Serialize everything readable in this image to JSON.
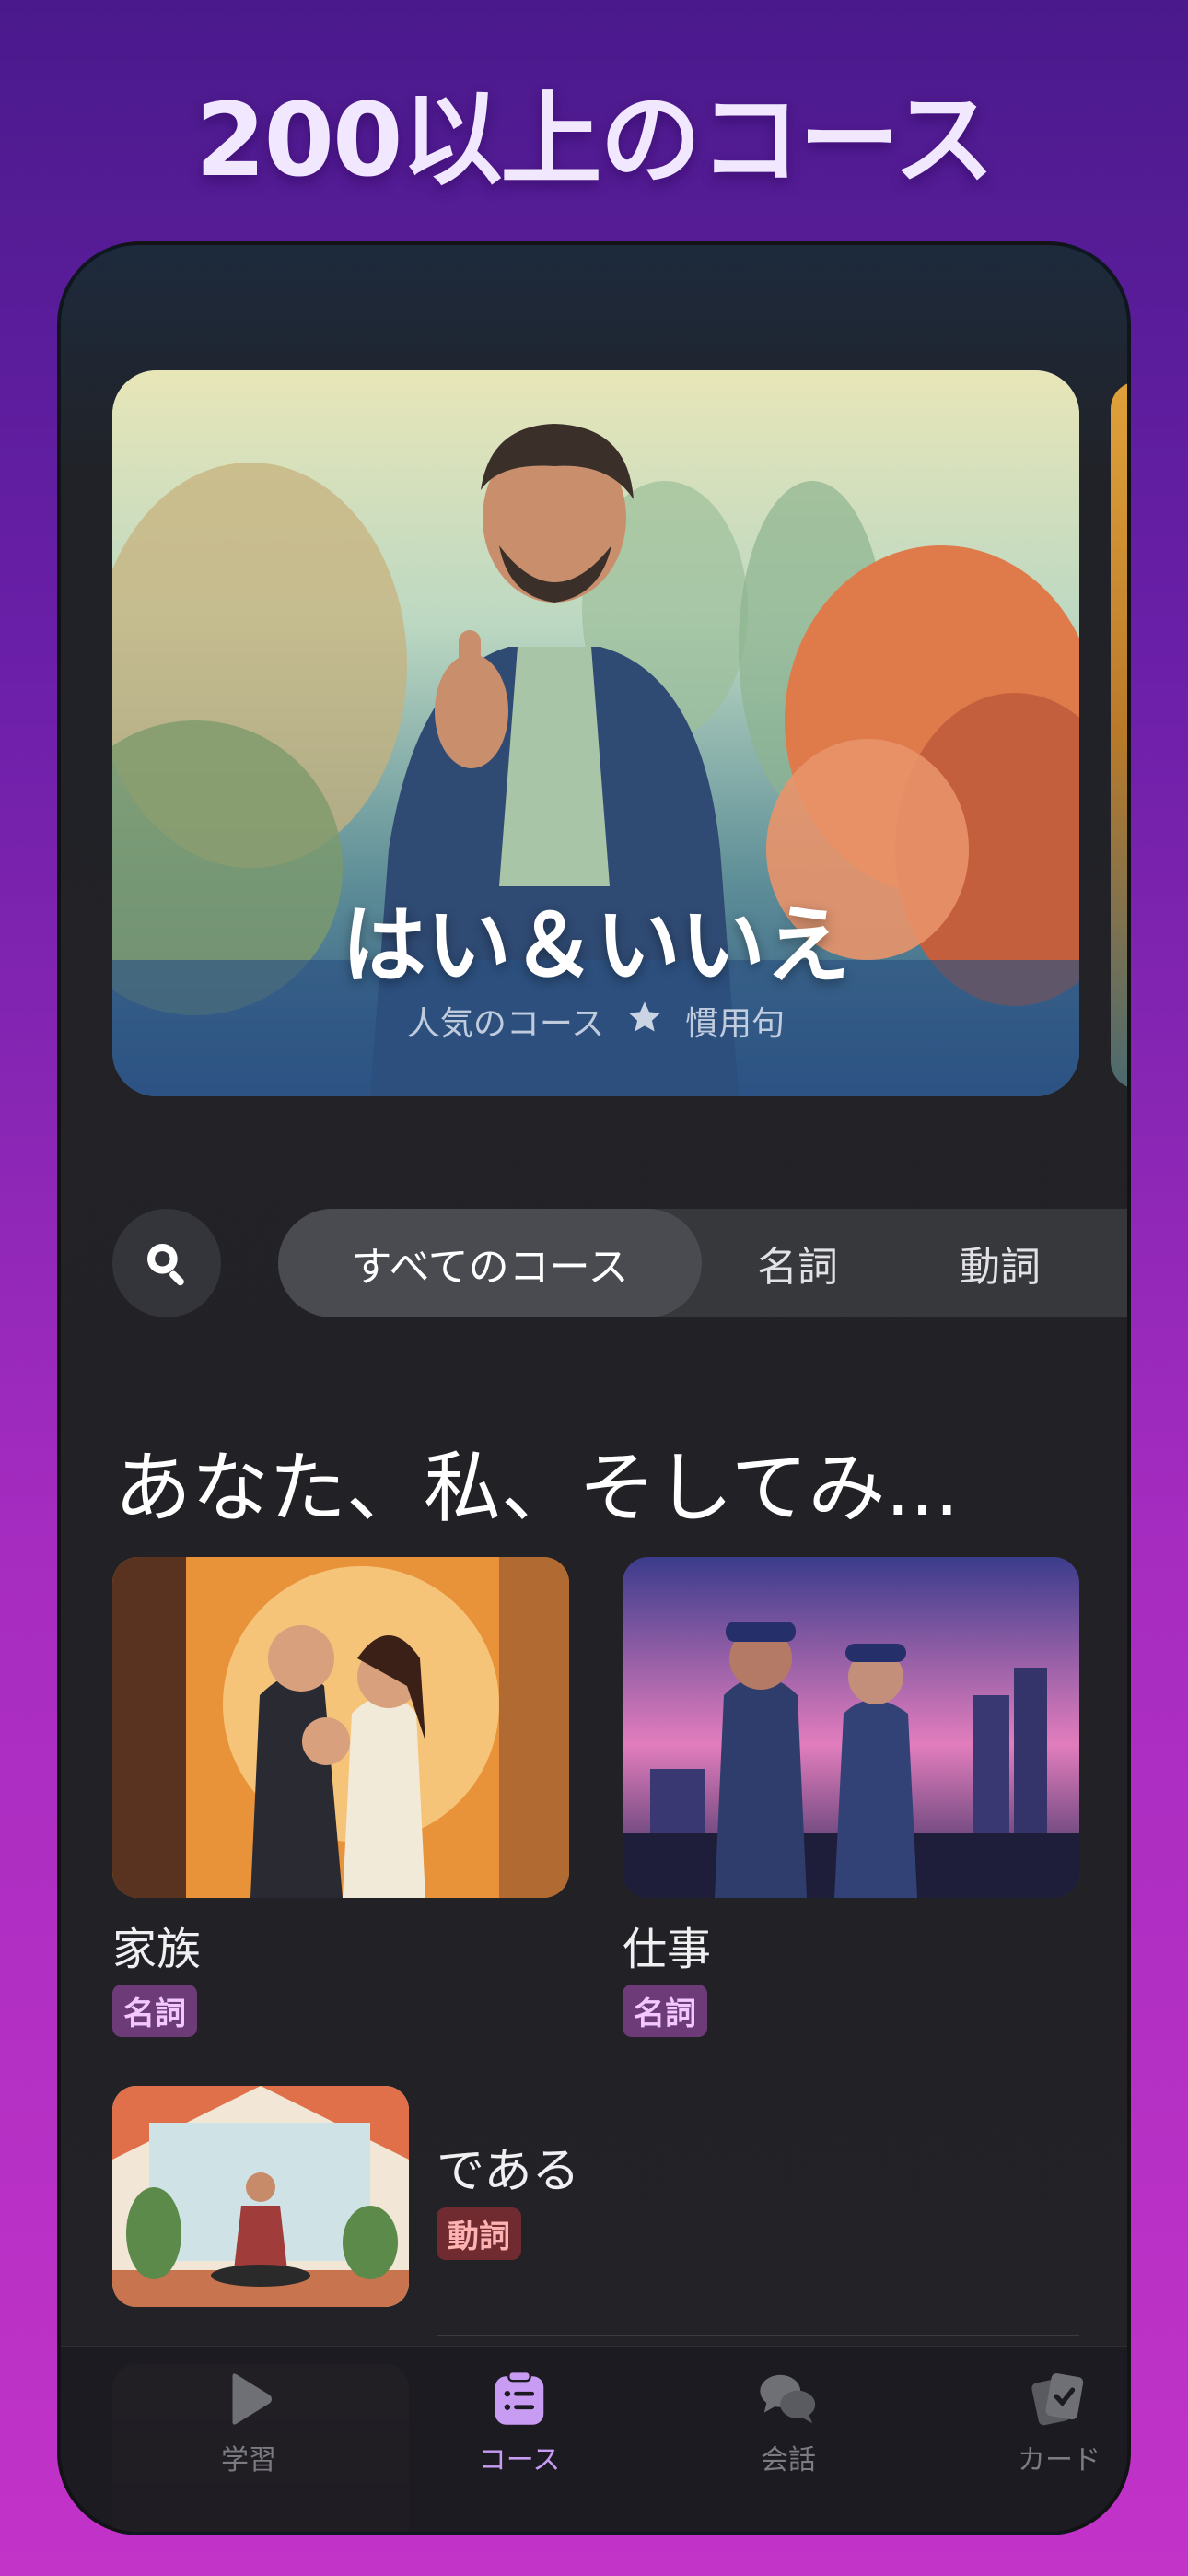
{
  "headline": "200以上のコース",
  "hero": {
    "title": "はい＆いいえ",
    "meta_left": "人気のコース",
    "meta_right": "慣用句"
  },
  "filters": {
    "search_icon": "search-icon",
    "chips": [
      "すべてのコース",
      "名詞",
      "動詞"
    ],
    "selected": "すべてのコース"
  },
  "section": {
    "title": "あなた、私、そしてみ...",
    "cards": [
      {
        "name": "家族",
        "tag": "名詞"
      },
      {
        "name": "仕事",
        "tag": "名詞"
      }
    ],
    "list": [
      {
        "name": "である",
        "tag": "動詞"
      }
    ]
  },
  "tabbar": {
    "items": [
      {
        "label": "学習",
        "icon": "play-icon"
      },
      {
        "label": "コース",
        "icon": "course-list-icon"
      },
      {
        "label": "会話",
        "icon": "chat-bubbles-icon"
      },
      {
        "label": "カード",
        "icon": "cards-icon"
      }
    ],
    "active": "コース"
  },
  "colors": {
    "accent": "#c79cf2",
    "noun_badge": "#6c3b78",
    "verb_badge": "#6f2b2f"
  }
}
